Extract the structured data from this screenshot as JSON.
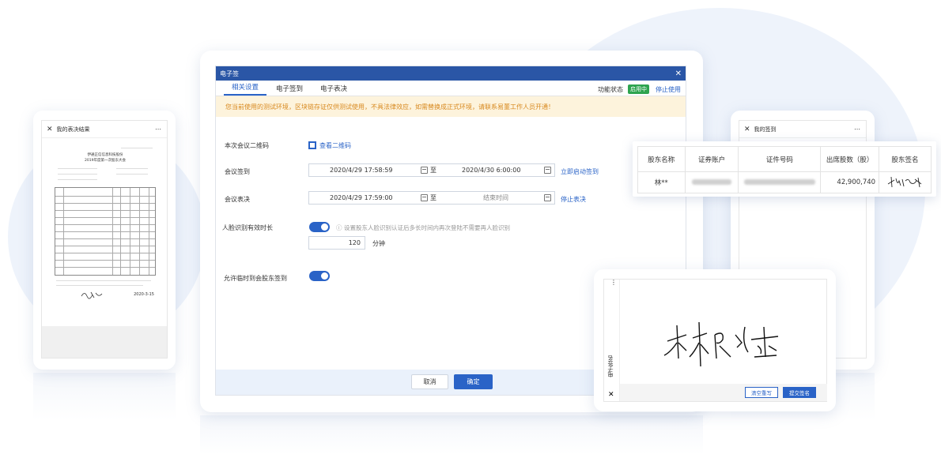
{
  "left_tablet": {
    "title": "我的表决结果",
    "doc_title1": "伊通正信信息科技股份",
    "doc_title2": "2019年度第一次股东大会",
    "footer_date": "2020-3-15"
  },
  "main_window": {
    "title": "电子签",
    "tabs": [
      "相关设置",
      "电子签到",
      "电子表决"
    ],
    "status_label": "功能状态",
    "status_badge": "启用中",
    "stop_use": "停止使用",
    "notice": "您当前使用的测试环境，区块链存证仅供测试使用，不具法律效应，如需替换成正式环境，请联系易董工作人员开通！",
    "qr_label": "本次会议二维码",
    "qr_link": "查看二维码",
    "checkin_label": "会议签到",
    "checkin_start": "2020/4/29 17:58:59",
    "checkin_to": "至",
    "checkin_end": "2020/4/30 6:00:00",
    "checkin_action": "立即启动签到",
    "vote_label": "会议表决",
    "vote_start": "2020/4/29 17:59:00",
    "vote_to": "至",
    "vote_end_placeholder": "结束时间",
    "vote_action": "停止表决",
    "face_label": "人脸识别有效时长",
    "face_hint": "设置股东人脸识别认证后多长时间内再次登陆不需要再人脸识别",
    "face_value": "120",
    "face_unit": "分钟",
    "temp_label": "允许临时到会股东签到",
    "cancel": "取消",
    "confirm": "确定"
  },
  "right_tablet": {
    "title": "我的签到"
  },
  "table_card": {
    "headers": [
      "股东名称",
      "证券账户",
      "证件号码",
      "出席股数（股）",
      "股东签名"
    ],
    "row": {
      "name": "林**",
      "shares": "42,900,740"
    }
  },
  "sign_tablet": {
    "side_title": "电子签名",
    "clear_button": "清空重写",
    "submit_button": "提交签名"
  },
  "colors": {
    "primary": "#2a63c7",
    "titlebar": "#2a56a6",
    "badge": "#2ea44f",
    "notice_bg": "#fdf3dc",
    "notice_text": "#d8891f"
  }
}
